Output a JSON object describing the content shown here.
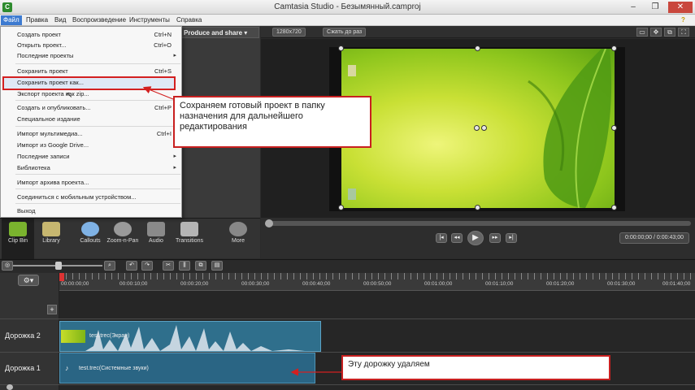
{
  "titlebar": {
    "app_icon": "C",
    "title": "Camtasia Studio - Безымянный.camproj",
    "minimize": "–",
    "maximize": "❐",
    "close": "✕"
  },
  "menubar": {
    "items": [
      "Файл",
      "Правка",
      "Вид",
      "Воспроизведение",
      "Инструменты",
      "Справка"
    ],
    "help_icon": "?"
  },
  "file_menu": {
    "items": [
      {
        "label": "Создать проект",
        "shortcut": "Ctrl+N"
      },
      {
        "label": "Открыть проект...",
        "shortcut": "Ctrl+O"
      },
      {
        "label": "Последние проекты",
        "shortcut": "▸"
      },
      {
        "label": "Сохранить проект",
        "shortcut": "Ctrl+S"
      },
      {
        "label": "Сохранить проект как...",
        "shortcut": ""
      },
      {
        "label": "Экспорт проекта как zip...",
        "shortcut": ""
      },
      {
        "label": "Создать и опубликовать...",
        "shortcut": "Ctrl+P"
      },
      {
        "label": "Специальное издание",
        "shortcut": ""
      },
      {
        "label": "Импорт мультимедиа...",
        "shortcut": "Ctrl+I"
      },
      {
        "label": "Импорт из Google Drive...",
        "shortcut": ""
      },
      {
        "label": "Последние записи",
        "shortcut": "▸"
      },
      {
        "label": "Библиотека",
        "shortcut": "▸"
      },
      {
        "label": "Импорт архива проекта...",
        "shortcut": ""
      },
      {
        "label": "Соединиться с мобильным устройством...",
        "shortcut": ""
      },
      {
        "label": "Выход",
        "shortcut": ""
      }
    ]
  },
  "produce": {
    "label": "Produce and share ▾"
  },
  "preview_toolbar": {
    "resolution": "1280x720",
    "zoom_label": "Сжать до раз",
    "icons": [
      "crop-icon",
      "pan-icon",
      "detach-icon",
      "fullscreen-icon"
    ]
  },
  "tool_tabs": [
    {
      "label": "Clip Bin",
      "color": "#7ab32e"
    },
    {
      "label": "Library",
      "color": "#c7b770"
    },
    {
      "label": "Callouts",
      "color": "#7fb2e5"
    },
    {
      "label": "Zoom-n-Pan",
      "color": "#9a9a9a"
    },
    {
      "label": "Audio",
      "color": "#8a8a8a"
    },
    {
      "label": "Transitions",
      "color": "#b5b5b5"
    },
    {
      "label": "More",
      "color": "#888888"
    }
  ],
  "playback": {
    "time": "0:00:00;00 / 0:00:43;00",
    "buttons": [
      "|◂",
      "◂◂",
      "▶",
      "▸▸",
      "▸|"
    ]
  },
  "timeline": {
    "timecodes": [
      "00:00:00;00",
      "00:00:10;00",
      "00:00:20;00",
      "00:00:30;00",
      "00:00:40;00",
      "00:00:50;00",
      "00:01:00;00",
      "00:01:10;00",
      "00:01:20;00",
      "00:01:30;00",
      "00:01:40;00"
    ],
    "gear": "⚙▾",
    "add_track": "+",
    "tracks": [
      {
        "name": "Дорожка 2",
        "clip": "test.trec(Экран)"
      },
      {
        "name": "Дорожка 1",
        "clip": "test.trec(Системные звуки)"
      }
    ]
  },
  "callouts": {
    "save_note": "Сохраняем готовый проект в папку назначения для дальнейшего редактирования",
    "track_note": "Эту дорожку удаляем"
  },
  "colors": {
    "annotation_red": "#d32020",
    "menu_active": "#3d7bd1",
    "clip_blue": "#2f6f8c"
  }
}
